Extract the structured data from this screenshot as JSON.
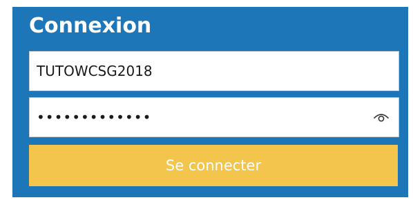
{
  "login": {
    "title": "Connexion",
    "username": {
      "value": "TUTOWCSG2018",
      "placeholder": ""
    },
    "password": {
      "value": "•••••••••••••",
      "masked": true,
      "toggle_icon": "eye-icon"
    },
    "submit_label": "Se connecter"
  },
  "colors": {
    "panel_background": "#1c76b8",
    "title_text": "#ffffff",
    "button_background": "#f3c54c",
    "button_text": "#ffffff",
    "field_background": "#ffffff"
  }
}
